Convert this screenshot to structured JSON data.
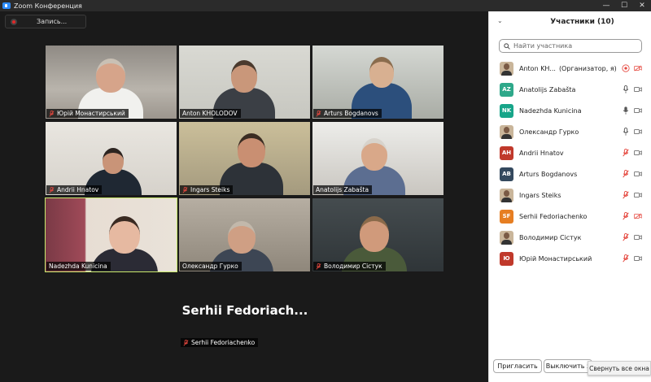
{
  "window": {
    "title": "Zoom Конференция",
    "controls": [
      "—",
      "☐",
      "✕"
    ]
  },
  "meeting": {
    "record_label": "Запись...",
    "tiles": [
      {
        "name": "Юрій Монастирський",
        "muted": true
      },
      {
        "name": "Anton KHOLODOV",
        "muted": false
      },
      {
        "name": "Arturs Bogdanovs",
        "muted": true
      },
      {
        "name": "Andrii Hnatov",
        "muted": true
      },
      {
        "name": "Ingars Steiks",
        "muted": true
      },
      {
        "name": "Anatolijs Zabašta",
        "muted": false
      },
      {
        "name": "Nadezhda Kunicina",
        "muted": false,
        "active": true
      },
      {
        "name": "Олександр Гурко",
        "muted": false
      },
      {
        "name": "Володимир  Сістук",
        "muted": true
      },
      {
        "name": "Serhii Fedoriachenko",
        "muted": true,
        "video_off": true,
        "display_name": "Serhii  Fedoriach..."
      }
    ],
    "active_border_color": "#c9e96b"
  },
  "panel": {
    "title": "Участники (10)",
    "search_placeholder": "Найти участника",
    "participants": [
      {
        "name": "Anton KH...",
        "extra": "(Организатор, я)",
        "avatar": "photo",
        "mic": "speaking",
        "video": "off"
      },
      {
        "name": "Anatolijs Zabašta",
        "initials": "AZ",
        "color": "#2ea88a",
        "mic": "on",
        "video": "on"
      },
      {
        "name": "Nadezhda Kunicina",
        "initials": "NK",
        "color": "#17a589",
        "mic": "on-solid",
        "video": "on"
      },
      {
        "name": "Олександр Гурко",
        "avatar": "photo",
        "mic": "on",
        "video": "on"
      },
      {
        "name": "Andrii Hnatov",
        "initials": "AH",
        "color": "#c0392b",
        "mic": "muted",
        "video": "on"
      },
      {
        "name": "Arturs Bogdanovs",
        "initials": "AB",
        "color": "#34495e",
        "mic": "muted",
        "video": "on"
      },
      {
        "name": "Ingars Steiks",
        "avatar": "photo",
        "mic": "muted",
        "video": "on"
      },
      {
        "name": "Serhii Fedoriachenko",
        "initials": "SF",
        "color": "#e67e22",
        "mic": "muted",
        "video": "off"
      },
      {
        "name": "Володимир  Сістук",
        "avatar": "photo",
        "mic": "muted",
        "video": "on"
      },
      {
        "name": "Юрій Монастирський",
        "initials": "Ю",
        "color": "#c0392b",
        "mic": "muted",
        "video": "on"
      }
    ],
    "invite_label": "Пригласить",
    "mute_all_label": "Выключить з",
    "tooltip": "Свернуть все окна"
  }
}
